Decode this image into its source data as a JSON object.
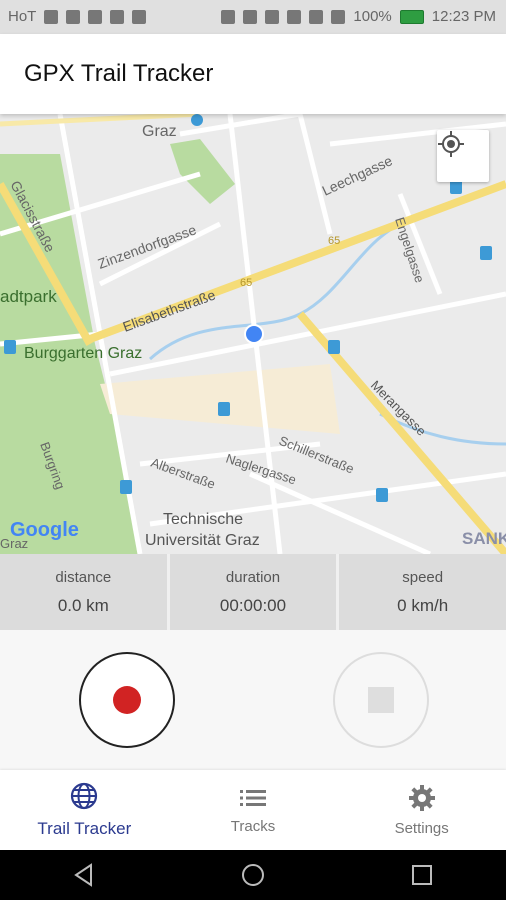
{
  "status_bar": {
    "carrier": "HoT",
    "battery": "100%",
    "time": "12:23 PM",
    "icons_left": [
      "usb-icon",
      "heart-icon",
      "mail-icon",
      "flag-icon",
      "notification-icon"
    ],
    "icons_right": [
      "location-icon",
      "bluetooth-icon",
      "nfc-icon",
      "vibrate-icon",
      "wifi-icon",
      "signal-icon",
      "battery-icon"
    ]
  },
  "app_bar": {
    "title": "GPX Trail Tracker"
  },
  "map": {
    "labels": [
      {
        "id": "graz",
        "text": "Graz"
      },
      {
        "id": "leechgasse",
        "text": "Leechgasse"
      },
      {
        "id": "glacisstrasse",
        "text": "Glacisstraße"
      },
      {
        "id": "zinzendorfgasse",
        "text": "Zinzendorfgasse"
      },
      {
        "id": "engelgasse",
        "text": "Engelgasse"
      },
      {
        "id": "stadtpark",
        "text": "adtpark"
      },
      {
        "id": "elisabethstrasse",
        "text": "Elisabethstraße"
      },
      {
        "id": "route65a",
        "text": "65"
      },
      {
        "id": "route65b",
        "text": "65"
      },
      {
        "id": "burggarten",
        "text": "Burggarten Graz"
      },
      {
        "id": "merangasse",
        "text": "Merangasse"
      },
      {
        "id": "schillerstrasse",
        "text": "Schillerstraße"
      },
      {
        "id": "burgring",
        "text": "Burgring"
      },
      {
        "id": "alberstrasse",
        "text": "Alberstraße"
      },
      {
        "id": "naglergasse",
        "text": "Naglergasse"
      },
      {
        "id": "tu1",
        "text": "Technische"
      },
      {
        "id": "tu2",
        "text": "Universität Graz"
      },
      {
        "id": "sank",
        "text": "SANK"
      },
      {
        "id": "graz2",
        "text": "Graz"
      },
      {
        "id": "google",
        "text": "Google"
      }
    ]
  },
  "stats": {
    "distance": {
      "label": "distance",
      "value": "0.0 km"
    },
    "duration": {
      "label": "duration",
      "value": "00:00:00"
    },
    "speed": {
      "label": "speed",
      "value": "0 km/h"
    }
  },
  "controls": {
    "record_icon": "record-icon",
    "stop_icon": "stop-icon"
  },
  "bottom_nav": [
    {
      "label": "Trail Tracker",
      "icon": "globe-icon",
      "active": true
    },
    {
      "label": "Tracks",
      "icon": "list-icon",
      "active": false
    },
    {
      "label": "Settings",
      "icon": "gear-icon",
      "active": false
    }
  ],
  "colors": {
    "accent": "#2b3a8f",
    "record": "#d12323",
    "park": "#b8dba0",
    "road_major": "#f7e08a",
    "water": "#a7cfee",
    "location_dot": "#4285f4"
  }
}
